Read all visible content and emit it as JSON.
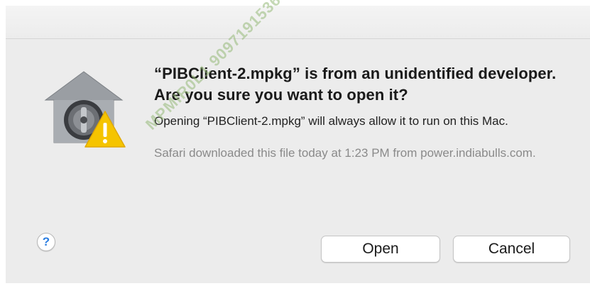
{
  "dialog": {
    "headline": "“PIBClient-2.mpkg” is from an unidentified developer. Are you sure you want to open it?",
    "body": "Opening “PIBClient-2.mpkg” will always allow it to run on this Mac.",
    "info": "Safari downloaded this file today at 1:23 PM from power.indiabulls.com.",
    "icon": "gatekeeper-warning-icon",
    "help_label": "?",
    "buttons": {
      "open": "Open",
      "cancel": "Cancel"
    }
  },
  "watermark": {
    "text": "MPMIR0L1 9097191536"
  },
  "colors": {
    "dialog_bg": "#ececec",
    "help_accent": "#2a7de1",
    "warning_yellow": "#f5c400"
  }
}
